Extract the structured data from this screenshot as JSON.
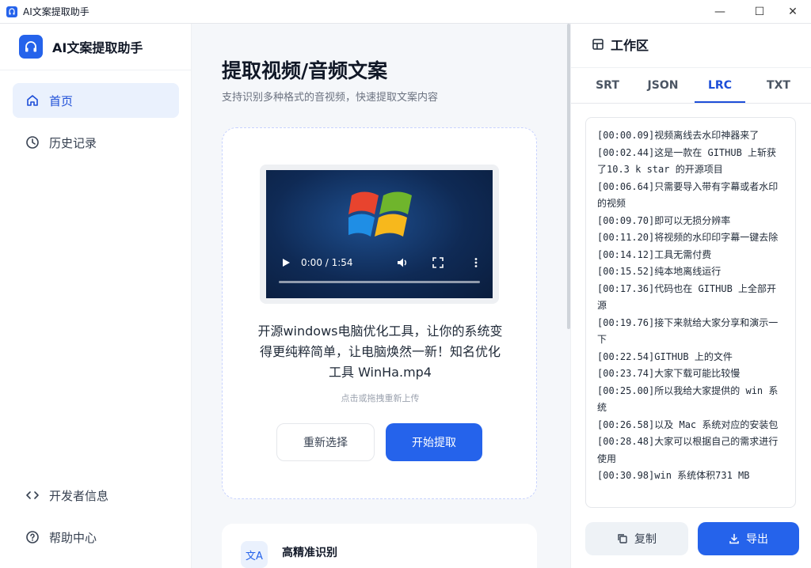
{
  "window": {
    "title": "AI文案提取助手",
    "controls": {
      "minimize": "—",
      "maximize": "☐",
      "close": "✕"
    }
  },
  "sidebar": {
    "brand": "AI文案提取助手",
    "nav": [
      {
        "label": "首页",
        "icon": "home-icon",
        "active": true
      },
      {
        "label": "历史记录",
        "icon": "clock-icon",
        "active": false
      }
    ],
    "footer": [
      {
        "label": "开发者信息",
        "icon": "code-icon"
      },
      {
        "label": "帮助中心",
        "icon": "help-circle-icon"
      }
    ]
  },
  "main": {
    "title": "提取视频/音频文案",
    "subtitle": "支持识别多种格式的音视频，快速提取文案内容",
    "video": {
      "time": "0:00 / 1:54",
      "progress": 0
    },
    "file_name": "开源windows电脑优化工具，让你的系统变得更纯粹简单，让电脑焕然一新！知名优化工具 WinHa.mp4",
    "hint": "点击或拖拽重新上传",
    "reselect_label": "重新选择",
    "start_label": "开始提取",
    "feature": {
      "icon_text": "文A",
      "title": "高精准识别"
    }
  },
  "workspace": {
    "title": "工作区",
    "tabs": [
      {
        "label": "SRT",
        "active": false
      },
      {
        "label": "JSON",
        "active": false
      },
      {
        "label": "LRC",
        "active": true
      },
      {
        "label": "TXT",
        "active": false
      }
    ],
    "lrc_content": "[00:00.09]视频离线去水印神器来了\n[00:02.44]这是一款在 GITHUB 上斩获了10.3 k star 的开源项目\n[00:06.64]只需要导入带有字幕或者水印的视频\n[00:09.70]即可以无损分辨率\n[00:11.20]将视频的水印印字幕一键去除\n[00:14.12]工具无需付费\n[00:15.52]纯本地离线运行\n[00:17.36]代码也在 GITHUB 上全部开源\n[00:19.76]接下来就给大家分享和演示一下\n[00:22.54]GITHUB 上的文件\n[00:23.74]大家下载可能比较慢\n[00:25.00]所以我给大家提供的 win 系统\n[00:26.58]以及 Mac 系统对应的安装包\n[00:28.48]大家可以根据自己的需求进行使用\n[00:30.98]win 系统体积731 MB",
    "copy_label": "复制",
    "export_label": "导出"
  },
  "colors": {
    "accent": "#2563eb",
    "active_bg": "#eaf1fd",
    "main_bg": "#f5f7fa"
  }
}
